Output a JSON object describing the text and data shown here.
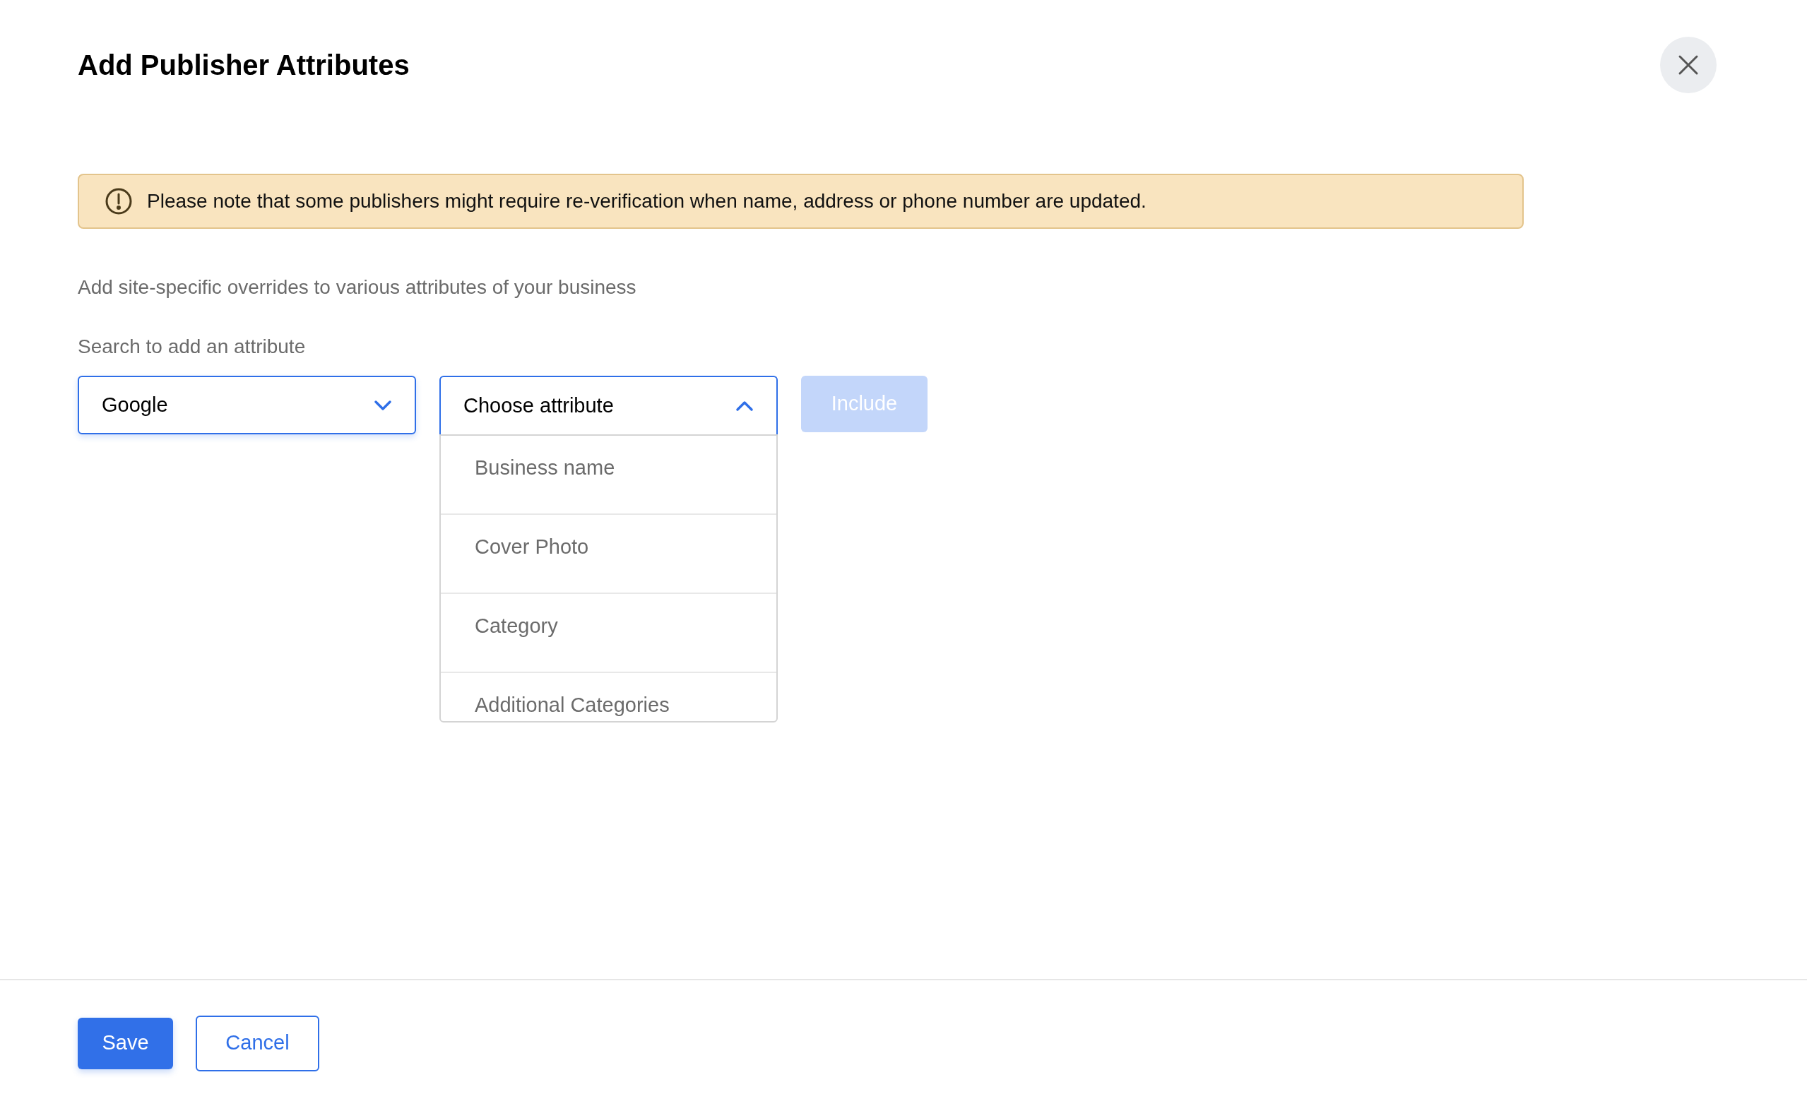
{
  "dialog": {
    "title": "Add Publisher Attributes"
  },
  "notice": {
    "text": "Please note that some publishers might require re-verification when name, address or phone number are updated."
  },
  "description": "Add site-specific overrides to various attributes of your business",
  "search_label": "Search to add an attribute",
  "publisher_select": {
    "value": "Google",
    "expanded": false
  },
  "attribute_select": {
    "placeholder": "Choose attribute",
    "expanded": true,
    "options": [
      {
        "label": "Business name"
      },
      {
        "label": "Cover Photo"
      },
      {
        "label": "Category"
      },
      {
        "label": "Additional Categories"
      }
    ]
  },
  "include_button": {
    "label": "Include",
    "disabled": true
  },
  "footer": {
    "buttons": [
      {
        "label": "Save",
        "kind": "primary"
      },
      {
        "label": "Cancel",
        "kind": "secondary"
      }
    ]
  }
}
